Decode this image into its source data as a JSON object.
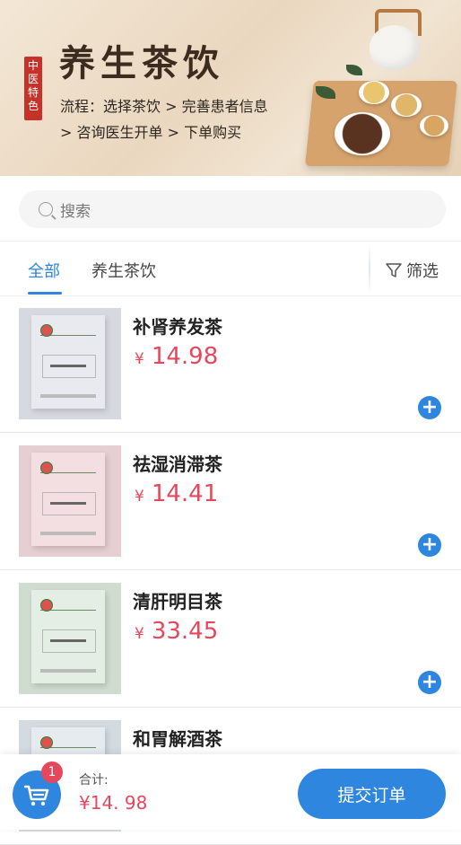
{
  "banner": {
    "stamp_chars": [
      "中",
      "医",
      "特",
      "色"
    ],
    "title": "养生茶饮",
    "flow_line1": "流程：选择茶饮 > 完善患者信息",
    "flow_line2": "> 咨询医生开单 > 下单购买"
  },
  "search": {
    "placeholder": "搜索"
  },
  "tabs": {
    "items": [
      {
        "label": "全部",
        "active": true
      },
      {
        "label": "养生茶饮",
        "active": false
      }
    ],
    "filter_label": "筛选"
  },
  "products": [
    {
      "name": "补肾养发茶",
      "currency": "¥",
      "price": "14.98",
      "box_color": "#e8eaf0",
      "bg_color": "#d7d9e0"
    },
    {
      "name": "祛湿消滞茶",
      "currency": "¥",
      "price": "14.41",
      "box_color": "#f3dfe2",
      "bg_color": "#e5cfd2"
    },
    {
      "name": "清肝明目茶",
      "currency": "¥",
      "price": "33.45",
      "box_color": "#e4eee4",
      "bg_color": "#cfdccf"
    },
    {
      "name": "和胃解酒茶",
      "currency": "¥",
      "price": "",
      "box_color": "#e6ebef",
      "bg_color": "#d3dbe1"
    }
  ],
  "cart": {
    "badge_count": "1",
    "total_label": "合计:",
    "total_value": "¥14. 98",
    "submit_label": "提交订单"
  },
  "colors": {
    "accent": "#2e86de",
    "price": "#e5475b"
  }
}
